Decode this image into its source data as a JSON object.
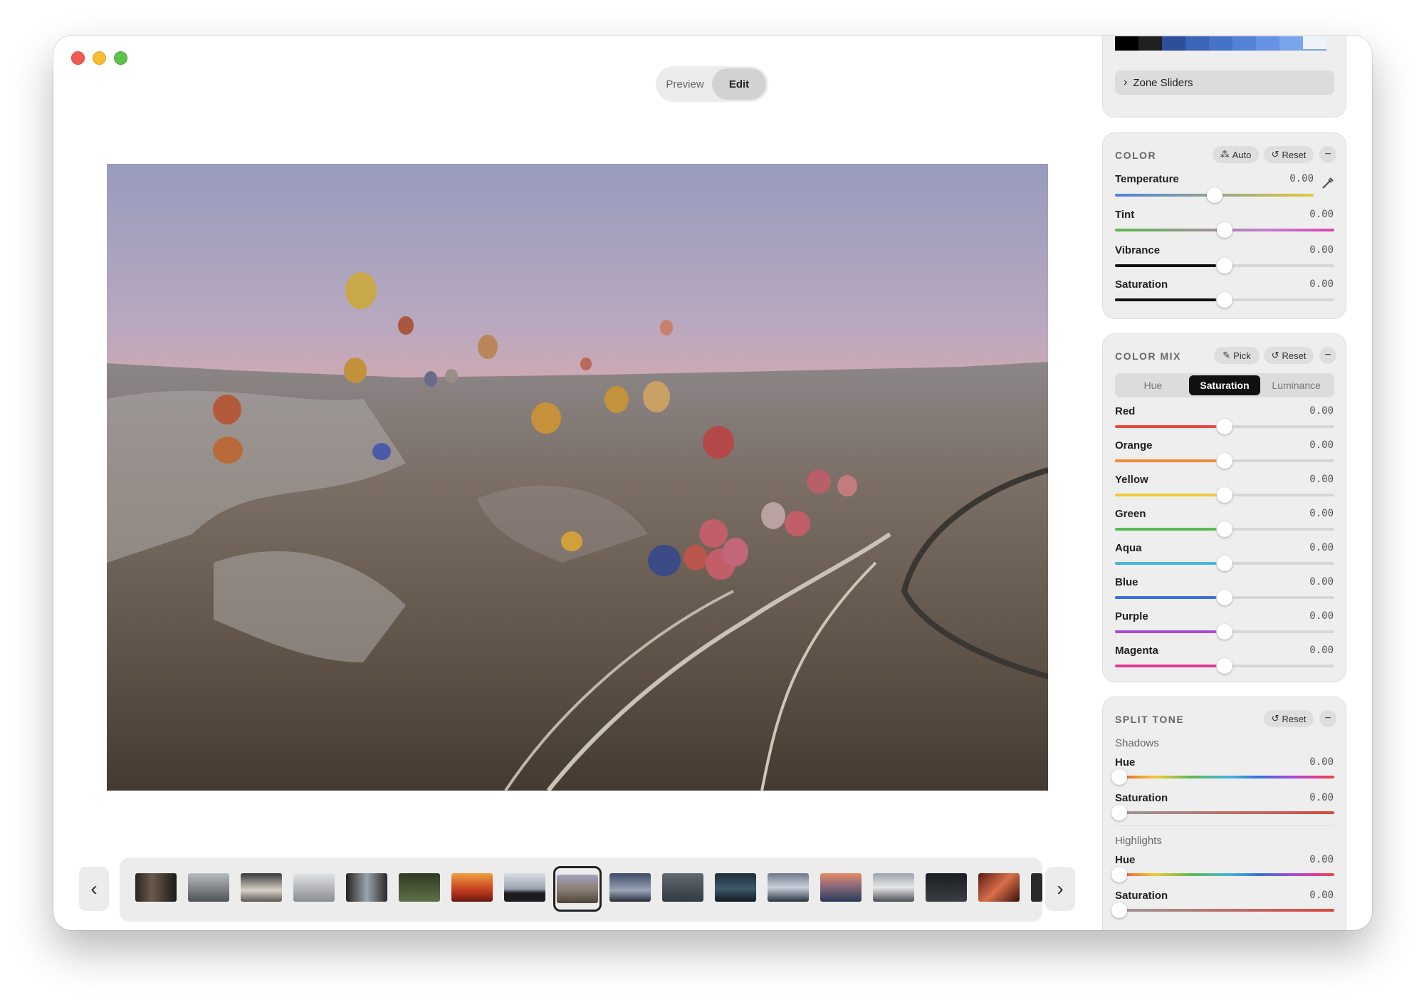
{
  "window": {
    "mode_tabs": [
      "Preview",
      "Edit"
    ],
    "active_mode": "Edit"
  },
  "filmstrip": {
    "prev_icon": "chevron-left-icon",
    "next_icon": "chevron-right-icon"
  },
  "tone_panel": {
    "zone_sliders_label": "Zone Sliders",
    "swatches": [
      "#000000",
      "#202020",
      "#2d4f9a",
      "#3a65b8",
      "#4573c8",
      "#5382d6",
      "#6592e2",
      "#7aa5ec",
      "#eef3fb"
    ]
  },
  "color": {
    "title": "COLOR",
    "auto_label": "Auto",
    "reset_label": "Reset",
    "collapse": "−",
    "sliders": [
      {
        "label": "Temperature",
        "value": "0.00"
      },
      {
        "label": "Tint",
        "value": "0.00"
      },
      {
        "label": "Vibrance",
        "value": "0.00"
      },
      {
        "label": "Saturation",
        "value": "0.00"
      }
    ]
  },
  "color_mix": {
    "title": "COLOR MIX",
    "pick_label": "Pick",
    "reset_label": "Reset",
    "collapse": "−",
    "tabs": [
      "Hue",
      "Saturation",
      "Luminance"
    ],
    "active_tab": "Saturation",
    "sliders": [
      {
        "label": "Red",
        "value": "0.00",
        "color": "#e8473e"
      },
      {
        "label": "Orange",
        "value": "0.00",
        "color": "#ef8a35"
      },
      {
        "label": "Yellow",
        "value": "0.00",
        "color": "#f0c93a"
      },
      {
        "label": "Green",
        "value": "0.00",
        "color": "#5cba55"
      },
      {
        "label": "Aqua",
        "value": "0.00",
        "color": "#47b6d8"
      },
      {
        "label": "Blue",
        "value": "0.00",
        "color": "#3a6fd8"
      },
      {
        "label": "Purple",
        "value": "0.00",
        "color": "#a94ad6"
      },
      {
        "label": "Magenta",
        "value": "0.00",
        "color": "#e0399a"
      }
    ]
  },
  "split_tone": {
    "title": "SPLIT TONE",
    "reset_label": "Reset",
    "collapse": "−",
    "shadows_label": "Shadows",
    "shadows": [
      {
        "label": "Hue",
        "value": "0.00"
      },
      {
        "label": "Saturation",
        "value": "0.00"
      }
    ],
    "highlights_label": "Highlights",
    "highlights": [
      {
        "label": "Hue",
        "value": "0.00"
      },
      {
        "label": "Saturation",
        "value": "0.00"
      }
    ]
  }
}
